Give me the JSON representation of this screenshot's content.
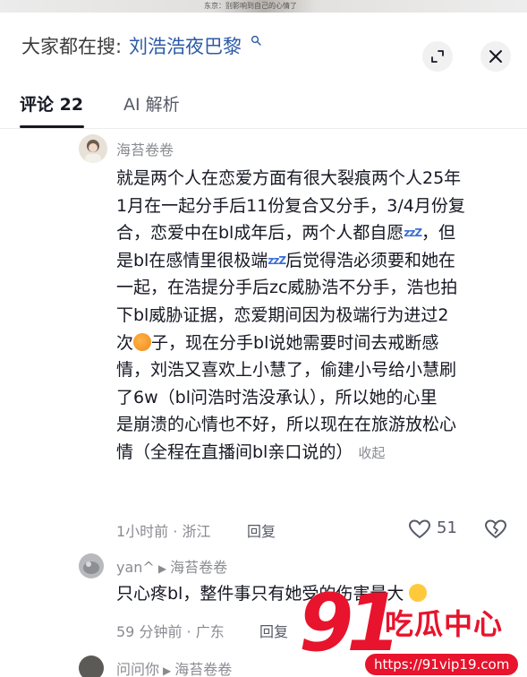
{
  "video": {
    "caption": "东京：别影响到自己的心情了"
  },
  "search": {
    "prefix": "大家都在搜:",
    "query": "刘浩浩夜巴黎",
    "icon": "search-icon"
  },
  "header_buttons": {
    "collapse_icon": "fullscreen-collapse-icon",
    "close_icon": "close-icon"
  },
  "tabs": [
    {
      "label": "评论 22",
      "active": true
    },
    {
      "label": "AI 解析",
      "active": false
    }
  ],
  "comments": [
    {
      "username": "海苔卷卷",
      "lines": [
        [
          "就是两个人在恋爱方面有很大裂痕两个人25年"
        ],
        [
          "1月在一起分手后11份复合又分手，3/4月份复"
        ],
        [
          "合，恋爱中在bl成年后，两个人都自愿",
          {
            "zzz": "zzZ"
          },
          "，但"
        ],
        [
          "是bl在感情里很极端",
          {
            "zzz": "zzZ"
          },
          "后觉得浩必须要和她在"
        ],
        [
          "一起，在浩提分手后zc威胁浩不分手，浩也拍"
        ],
        [
          "下bl威胁证据，恋爱期间因为极端行为进过2"
        ],
        [
          "次",
          {
            "emoji": "orange"
          },
          "子，现在分手bl说她需要时间去戒断感"
        ],
        [
          "情，刘浩又喜欢上小慧了，偷建小号给小慧刷"
        ],
        [
          "了6w（bl问浩时浩没承认），所以她的心里"
        ],
        [
          "是崩溃的心情也不好，所以现在在旅游放松心"
        ],
        [
          "情（全程在直播间bl亲口说的）"
        ]
      ],
      "collapse_label": "收起",
      "time_location": "1小时前 · 浙江",
      "reply_label": "回复",
      "likes": "51"
    },
    {
      "username": "yan^",
      "reply_to": "海苔卷卷",
      "text": "只心疼bl，整件事只有她受的伤害最大",
      "time_location": "59 分钟前 · 广东",
      "reply_label": "回复"
    },
    {
      "username": "问问你",
      "reply_to": "海苔卷卷"
    }
  ],
  "watermark": {
    "digits": "91",
    "text": "吃瓜中心",
    "url": "https://91vip19.com"
  },
  "colors": {
    "link_blue": "#2b5aa6",
    "brand_red": "#e8132c",
    "muted_gray": "#8a8b91"
  }
}
